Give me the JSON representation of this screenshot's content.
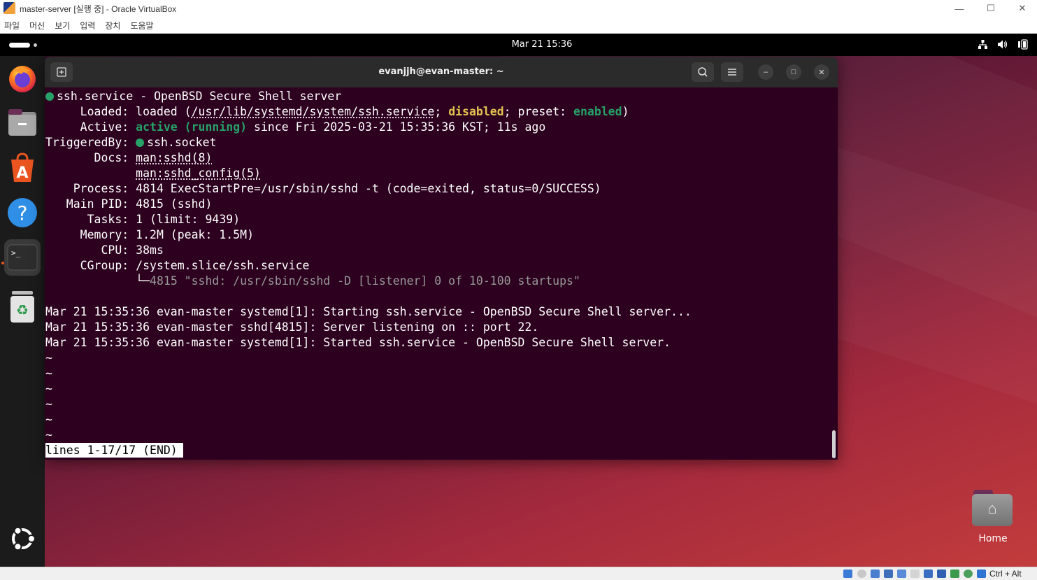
{
  "vbox": {
    "title": "master-server [실행 중] - Oracle VirtualBox",
    "menu": [
      "파일",
      "머신",
      "보기",
      "입력",
      "장치",
      "도움말"
    ],
    "minimize": "—",
    "maximize": "☐",
    "close": "✕",
    "host_key": "Ctrl + Alt"
  },
  "ubuntu": {
    "clock": "Mar 21  15:36",
    "tray": {
      "network": "⛶",
      "volume": "🔊",
      "battery": "▮"
    },
    "dock": [
      {
        "name": "firefox",
        "glyph": ""
      },
      {
        "name": "files",
        "glyph": "—"
      },
      {
        "name": "app-center",
        "glyph": "A"
      },
      {
        "name": "help",
        "glyph": "?"
      },
      {
        "name": "terminal",
        "glyph": ">_"
      },
      {
        "name": "trash",
        "glyph": "♻"
      }
    ],
    "desktop_icon_label": "Home"
  },
  "terminal": {
    "title": "evanjjh@evan-master: ~",
    "new_tab": "⊞",
    "search": "⌕",
    "menu": "≡",
    "minimize": "–",
    "maximize": "□",
    "close": "✕",
    "lines": {
      "l1": "ssh.service - OpenBSD Secure Shell server",
      "l2_a": "     Loaded: loaded (",
      "l2_b": "/usr/lib/systemd/system/ssh.service",
      "l2_c": "; ",
      "l2_d": "disabled",
      "l2_e": "; preset: ",
      "l2_f": "enabled",
      "l2_g": ")",
      "l3_a": "     Active: ",
      "l3_b": "active (running)",
      "l3_c": " since Fri 2025-03-21 15:35:36 KST; 11s ago",
      "l4_a": "TriggeredBy: ",
      "l4_b": "ssh.socket",
      "l5_a": "       Docs: ",
      "l5_b": "man:sshd(8)",
      "l6_a": "             ",
      "l6_b": "man:sshd_config(5)",
      "l7": "    Process: 4814 ExecStartPre=/usr/sbin/sshd -t (code=exited, status=0/SUCCESS)",
      "l8": "   Main PID: 4815 (sshd)",
      "l9": "      Tasks: 1 (limit: 9439)",
      "l10": "     Memory: 1.2M (peak: 1.5M)",
      "l11": "        CPU: 38ms",
      "l12": "     CGroup: /system.slice/ssh.service",
      "l13_a": "             └─",
      "l13_b": "4815 \"sshd: /usr/sbin/sshd -D [listener] 0 of 10-100 startups\"",
      "l14": "",
      "l15": "Mar 21 15:35:36 evan-master systemd[1]: Starting ssh.service - OpenBSD Secure Shell server...",
      "l16": "Mar 21 15:35:36 evan-master sshd[4815]: Server listening on :: port 22.",
      "l17": "Mar 21 15:35:36 evan-master systemd[1]: Started ssh.service - OpenBSD Secure Shell server.",
      "tilde": "~",
      "status": "lines 1-17/17 (END)"
    }
  }
}
